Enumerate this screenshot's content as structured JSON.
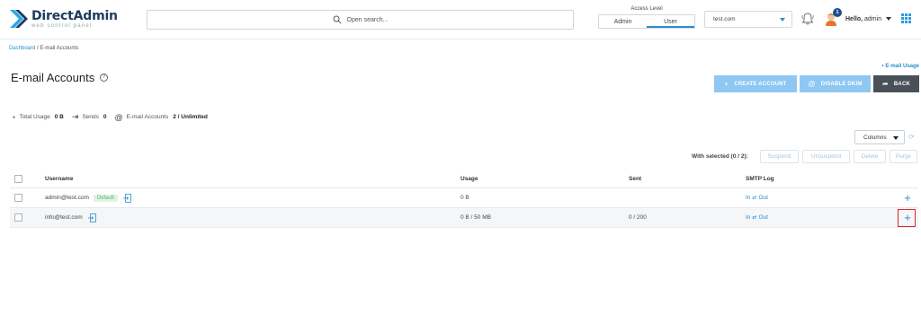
{
  "header": {
    "logo_title": "DirectAdmin",
    "logo_sub": "web control panel",
    "search_placeholder": "Open search...",
    "access_level_label": "Access Level",
    "access_options": [
      "Admin",
      "User"
    ],
    "access_selected": "User",
    "domain": "test.com",
    "notification_count": "1",
    "hello_prefix": "Hello,",
    "user": "admin"
  },
  "breadcrumb": {
    "home": "Dashboard",
    "sep": " / ",
    "current": "E-mail Accounts"
  },
  "usage_link": "• E-mail Usage",
  "page_title": "E-mail Accounts",
  "help": "?",
  "actions": {
    "create": "CREATE ACCOUNT",
    "dkim": "DISABLE DKIM",
    "back": "BACK"
  },
  "stats": {
    "total_usage_label": "Total Usage",
    "total_usage": "0 B",
    "sends_label": "Sends",
    "sends": "0",
    "accounts_label": "E-mail Accounts",
    "accounts": "2 / Unlimited"
  },
  "columns_label": "Columns",
  "bulk": {
    "label": "With selected (0 / 2):",
    "suspend": "Suspend",
    "unsuspend": "Unsuspend",
    "delete": "Delete",
    "purge": "Purge"
  },
  "table": {
    "headers": {
      "username": "Username",
      "usage": "Usage",
      "sent": "Sent",
      "smtp": "SMTP Log"
    },
    "rows": [
      {
        "username": "admin@test.com",
        "badge": "Default",
        "usage": "0 B",
        "sent": "",
        "in": "In",
        "sep": "⇄",
        "out": "Out"
      },
      {
        "username": "info@test.com",
        "badge": "",
        "usage": "0 B / 50 MB",
        "sent": "0 / 200",
        "in": "In",
        "sep": "⇄",
        "out": "Out"
      }
    ]
  },
  "colors": {
    "accent": "#2a8fd0",
    "button_light": "#8dc7f2",
    "button_dark": "#4a5057",
    "highlight": "#d8262f"
  }
}
